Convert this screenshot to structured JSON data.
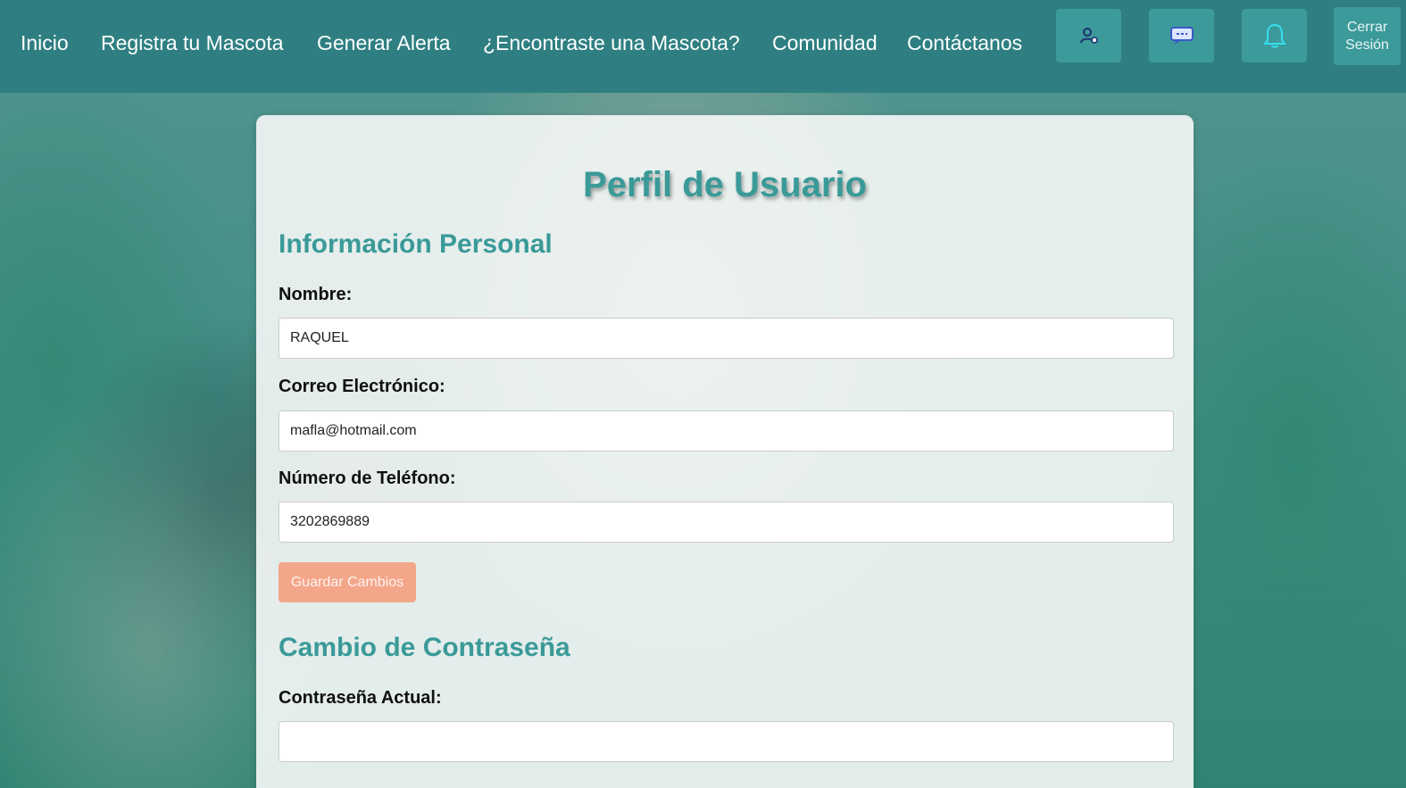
{
  "nav": {
    "links": [
      {
        "label": "Inicio"
      },
      {
        "label": "Registra tu Mascota"
      },
      {
        "label": "Generar Alerta"
      },
      {
        "label": "¿Encontraste una Mascota?"
      },
      {
        "label": "Comunidad"
      },
      {
        "label": "Contáctanos"
      }
    ],
    "icons": {
      "profile": "user-settings-icon",
      "chat": "chat-icon",
      "notifications": "bell-icon"
    },
    "logout_line1": "Cerrar",
    "logout_line2": "Sesión"
  },
  "profile": {
    "title": "Perfil de Usuario",
    "personal_section": "Información Personal",
    "name_label": "Nombre:",
    "name_value": "RAQUEL",
    "email_label": "Correo Electrónico:",
    "email_value": "mafla@hotmail.com",
    "phone_label": "Número de Teléfono:",
    "phone_value": "3202869889",
    "save_label": "Guardar Cambios",
    "password_section": "Cambio de Contraseña",
    "current_password_label": "Contraseña Actual:",
    "current_password_value": ""
  },
  "colors": {
    "navbar": "#2f7f82",
    "accent": "#3a9a98",
    "save_button": "#f4a68a"
  }
}
